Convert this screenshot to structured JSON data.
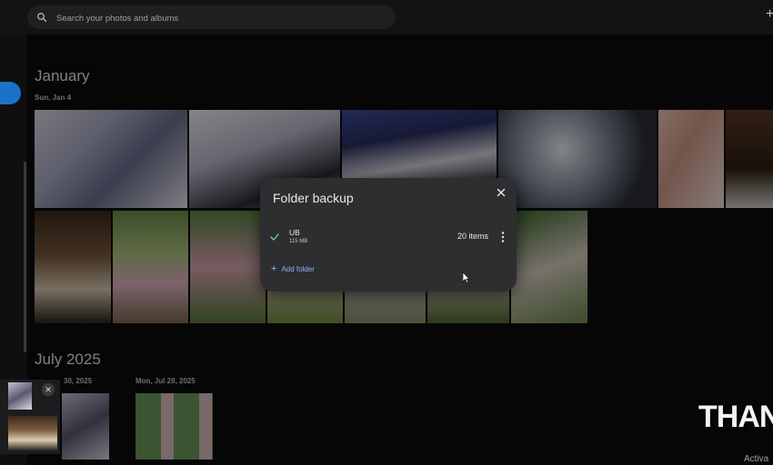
{
  "search": {
    "placeholder": "Search your photos and albums"
  },
  "sections": {
    "january": {
      "title": "January",
      "date": "Sun, Jan 4"
    },
    "july": {
      "title": "July 2025",
      "date1": "30, 2025",
      "date2": "Mon, Jul 28, 2025"
    }
  },
  "dialog": {
    "title": "Folder backup",
    "folder": {
      "name": "UB",
      "size": "115 MB",
      "count": "20 items"
    },
    "add_folder": "Add folder"
  },
  "watermark": "THANH",
  "activate": "Activa",
  "colors": {
    "accent": "#8ab4f8",
    "dialog_bg": "#2d2e30",
    "check": "#81c995"
  }
}
